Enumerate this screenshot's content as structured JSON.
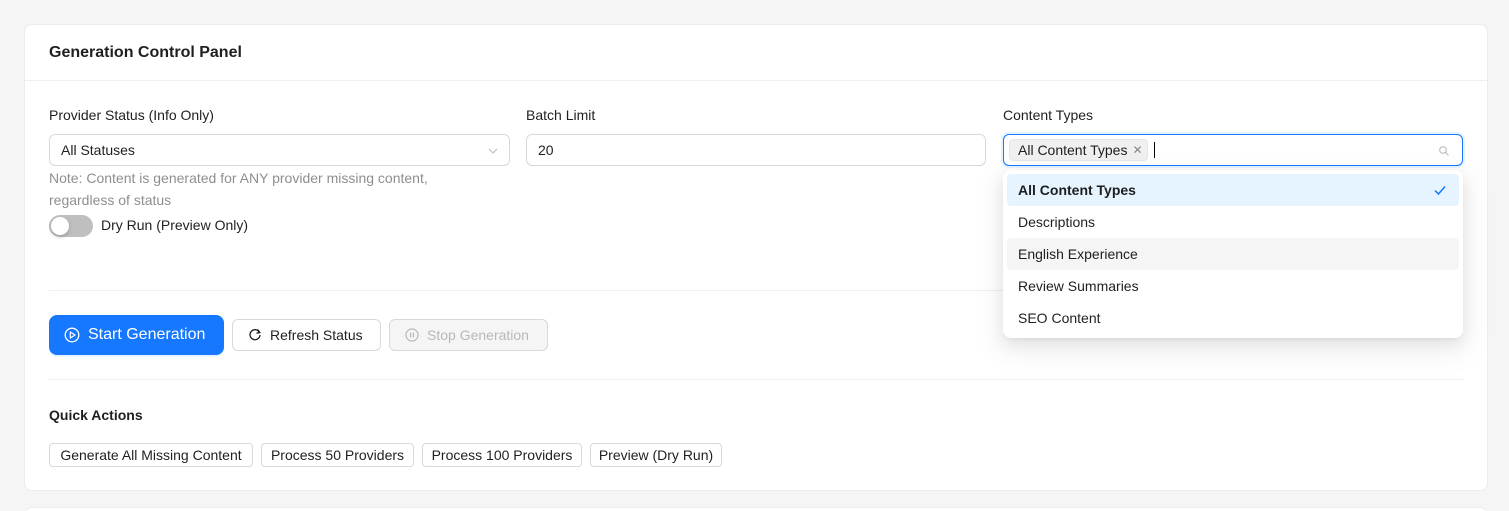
{
  "panel": {
    "title": "Generation Control Panel"
  },
  "provider_status": {
    "label": "Provider Status (Info Only)",
    "value": "All Statuses",
    "note": "Note: Content is generated for ANY provider missing content, regardless of status"
  },
  "batch_limit": {
    "label": "Batch Limit",
    "value": "20"
  },
  "content_types": {
    "label": "Content Types",
    "selected_tag": "All Content Types",
    "options": [
      {
        "label": "All Content Types",
        "selected": true
      },
      {
        "label": "Descriptions",
        "selected": false
      },
      {
        "label": "English Experience",
        "selected": false
      },
      {
        "label": "Review Summaries",
        "selected": false
      },
      {
        "label": "SEO Content",
        "selected": false
      }
    ]
  },
  "dry_run": {
    "label": "Dry Run (Preview Only)",
    "enabled": false
  },
  "actions": {
    "start": "Start Generation",
    "refresh": "Refresh Status",
    "stop": "Stop Generation"
  },
  "quick_actions": {
    "title": "Quick Actions",
    "buttons": [
      "Generate All Missing Content",
      "Process 50 Providers",
      "Process 100 Providers",
      "Preview (Dry Run)"
    ]
  },
  "colors": {
    "primary": "#1677ff",
    "selected_option_bg": "#e6f4ff",
    "hover_option_bg": "#f5f5f5"
  },
  "icons": {
    "start": "play-circle-icon",
    "refresh": "reload-icon",
    "stop": "pause-circle-icon",
    "select_arrow": "chevron-down-icon",
    "search": "search-icon",
    "remove_tag": "close-icon",
    "selected": "check-icon"
  }
}
